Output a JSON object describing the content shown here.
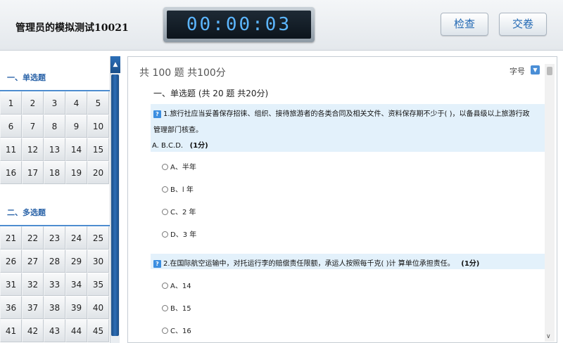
{
  "header": {
    "exam_title": "管理员的模拟测试10021",
    "timer": "00:00:03",
    "check_label": "检查",
    "submit_label": "交卷"
  },
  "nav": {
    "sections": [
      {
        "title": "一、单选题",
        "numbers": [
          "1",
          "2",
          "3",
          "4",
          "5",
          "6",
          "7",
          "8",
          "9",
          "10",
          "11",
          "12",
          "13",
          "14",
          "15",
          "16",
          "17",
          "18",
          "19",
          "20"
        ]
      },
      {
        "title": "二、多选题",
        "numbers": [
          "21",
          "22",
          "23",
          "24",
          "25",
          "26",
          "27",
          "28",
          "29",
          "30",
          "31",
          "32",
          "33",
          "34",
          "35",
          "36",
          "37",
          "38",
          "39",
          "40",
          "41",
          "42",
          "43",
          "44",
          "45"
        ]
      }
    ]
  },
  "main": {
    "summary": "共 100 题  共100分",
    "font_size_label": "字号",
    "section_title": "一、单选题 (共 20 题  共20分)",
    "q1": {
      "text_line1": "1.旅行社应当妥善保存招徕、组织、接待旅游者的各类合同及相关文件、资料保存期不少于( )，以备县级以上旅游行政",
      "text_line2": "管理部门核查。",
      "choices": "A. B.C.D.",
      "score": "(1分)",
      "options": [
        "A、半年",
        "B、l 年",
        "C、2 年",
        "D、3 年"
      ]
    },
    "q2": {
      "text": "2.在国际航空运输中，对托运行李的赔偿责任限额，承运人按照每千克( )计 算单位承担责任。",
      "score": "(1分)",
      "options": [
        "A、14",
        "B、15",
        "C、16"
      ]
    }
  },
  "icons": {
    "question": "question-mark-icon",
    "radio": "radio-circle-icon",
    "scroll_up": "up-arrow-icon",
    "font_toggle": "chevron-down-icon"
  }
}
